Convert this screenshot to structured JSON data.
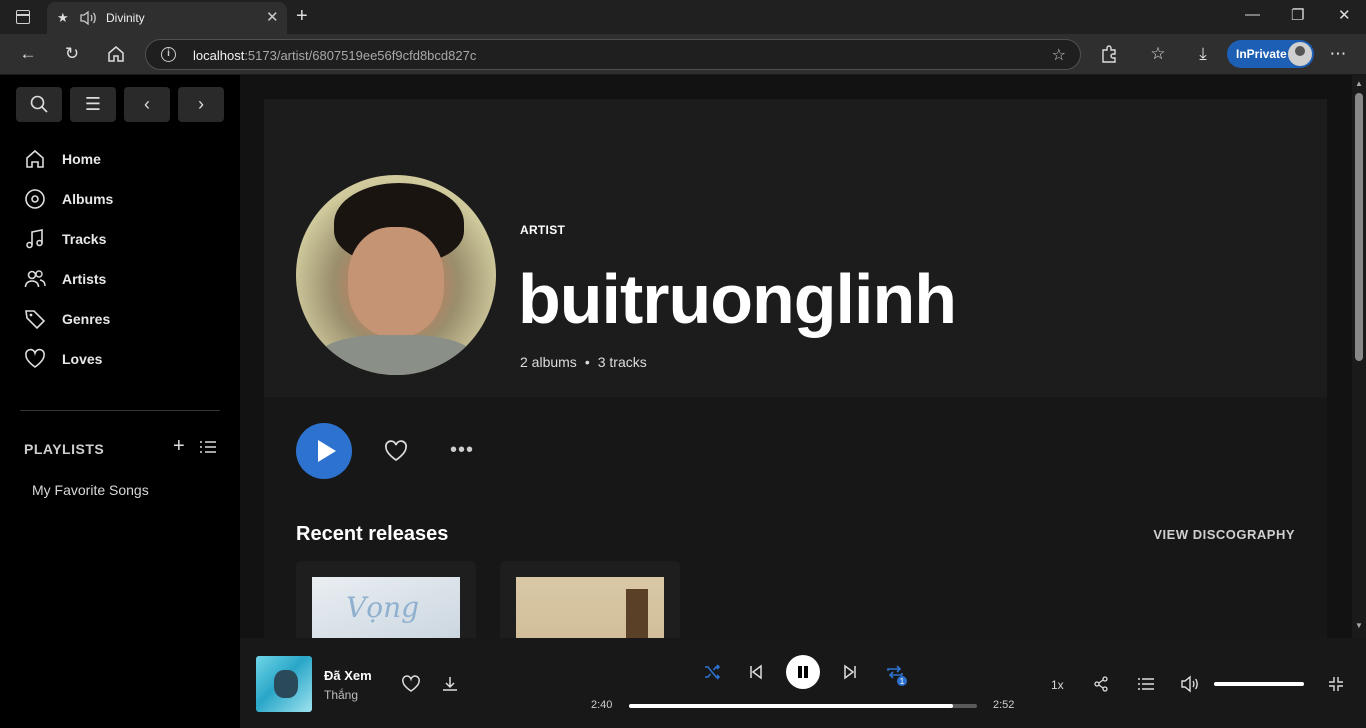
{
  "browser": {
    "tab_title": "Divinity",
    "url_host": "localhost",
    "url_path": ":5173/artist/6807519ee56f9cfd8bcd827c",
    "inprivate_label": "InPrivate"
  },
  "sidebar": {
    "nav": [
      {
        "label": "Home",
        "icon": "home-icon"
      },
      {
        "label": "Albums",
        "icon": "album-icon"
      },
      {
        "label": "Tracks",
        "icon": "music-note-icon"
      },
      {
        "label": "Artists",
        "icon": "users-icon"
      },
      {
        "label": "Genres",
        "icon": "tag-icon"
      },
      {
        "label": "Loves",
        "icon": "heart-icon"
      }
    ],
    "playlists_title": "PLAYLISTS",
    "playlists": [
      "My Favorite Songs"
    ]
  },
  "artist": {
    "type_label": "ARTIST",
    "name": "buitruonglinh",
    "albums": "2 albums",
    "separator": "•",
    "tracks": "3 tracks"
  },
  "section": {
    "recent_title": "Recent releases",
    "view_discography": "VIEW DISCOGRAPHY",
    "release_1_art_text": "Vọng"
  },
  "player": {
    "title": "Đã Xem",
    "artist": "Thắng",
    "elapsed": "2:40",
    "duration": "2:52",
    "progress": 0.93,
    "speed": "1x",
    "volume": 1.0,
    "repeat_badge": "1",
    "accent": "#2e72cf"
  }
}
